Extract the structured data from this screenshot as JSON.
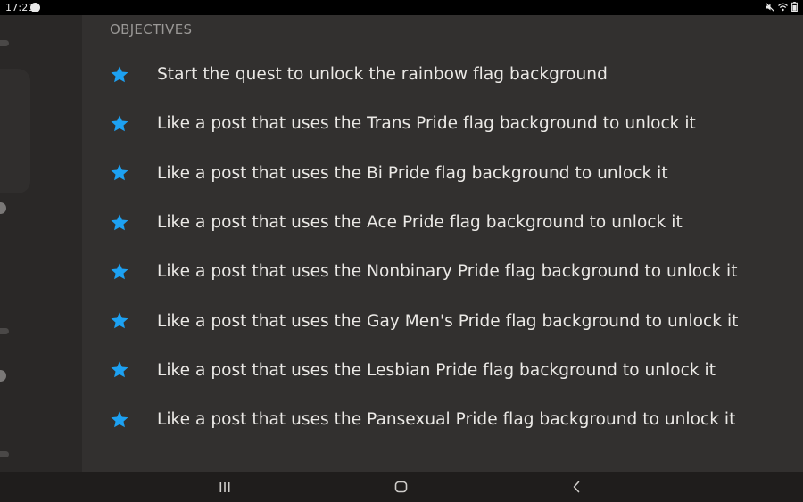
{
  "status_bar": {
    "time": "17:21"
  },
  "main": {
    "section_title": "OBJECTIVES",
    "objectives": [
      {
        "label": "Start the quest to unlock the rainbow flag background"
      },
      {
        "label": "Like a post that uses the Trans Pride flag background to unlock it"
      },
      {
        "label": "Like a post that uses the Bi Pride flag background to unlock it"
      },
      {
        "label": "Like a post that uses the Ace Pride flag background to unlock it"
      },
      {
        "label": "Like a post that uses the Nonbinary Pride flag background to unlock it"
      },
      {
        "label": "Like a post that uses the Gay Men's Pride flag background to unlock it"
      },
      {
        "label": "Like a post that uses the Lesbian Pride flag background to unlock it"
      },
      {
        "label": "Like a post that uses the Pansexual Pride flag background to unlock it"
      }
    ]
  },
  "theme": {
    "accent": "#1da1f2",
    "text": "#ebe9e6",
    "muted": "#9a9896",
    "background": "#32302f"
  },
  "icons": {
    "objective_bullet": "star-icon",
    "nav_recent": "recent-apps-icon",
    "nav_home": "home-icon",
    "nav_back": "back-icon"
  }
}
